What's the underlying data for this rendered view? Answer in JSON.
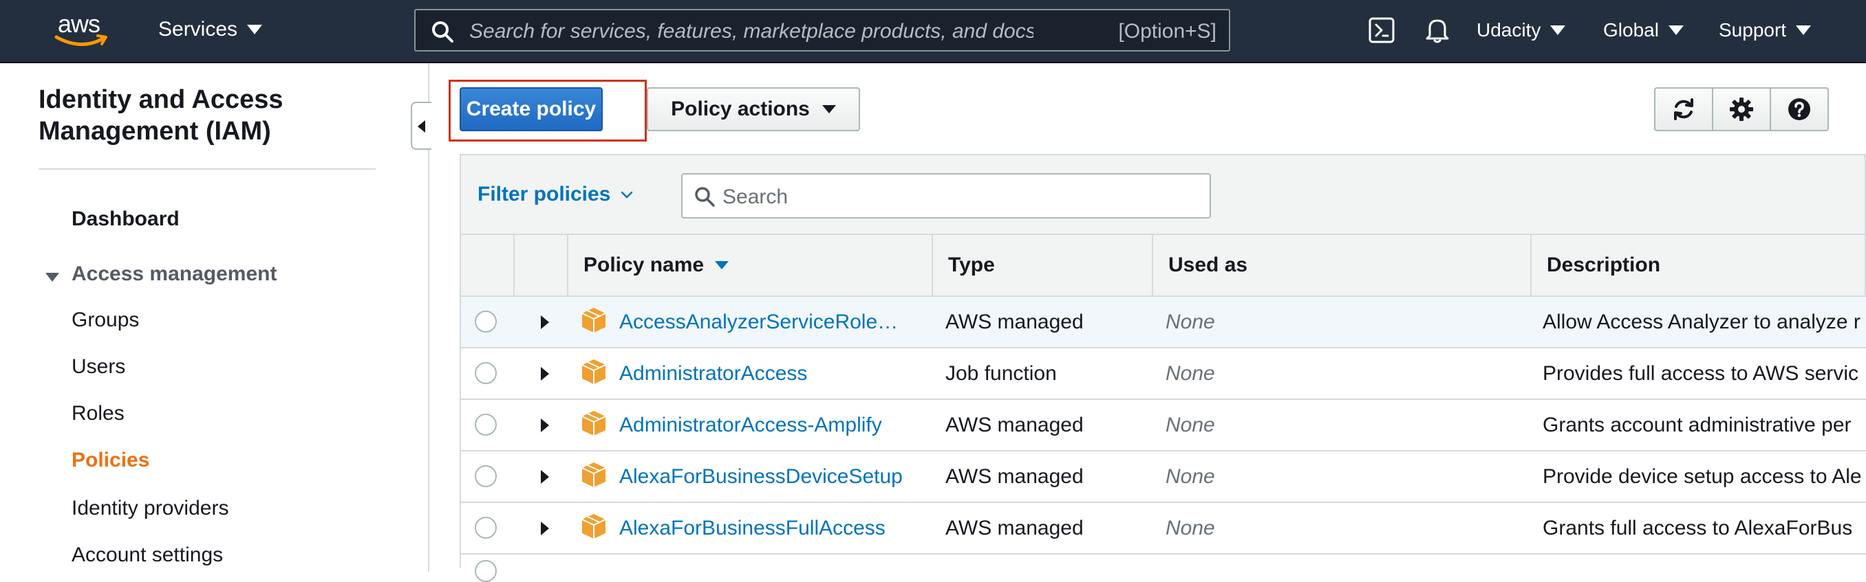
{
  "topnav": {
    "logo_text": "aws",
    "services_label": "Services",
    "search_placeholder": "Search for services, features, marketplace products, and docs",
    "search_shortcut": "[Option+S]",
    "account_label": "Udacity",
    "region_label": "Global",
    "support_label": "Support",
    "icons": [
      "cloudshell-icon",
      "bell-icon"
    ]
  },
  "sidebar": {
    "title": "Identity and Access Management (IAM)",
    "dashboard": "Dashboard",
    "section_label": "Access management",
    "items": [
      {
        "label": "Groups",
        "active": false
      },
      {
        "label": "Users",
        "active": false
      },
      {
        "label": "Roles",
        "active": false
      },
      {
        "label": "Policies",
        "active": true
      },
      {
        "label": "Identity providers",
        "active": false
      },
      {
        "label": "Account settings",
        "active": false
      }
    ]
  },
  "toolbar": {
    "create_label": "Create policy",
    "actions_label": "Policy actions",
    "icon_buttons": [
      "refresh-icon",
      "gear-icon",
      "help-icon"
    ]
  },
  "filter": {
    "label": "Filter policies",
    "search_placeholder": "Search"
  },
  "table": {
    "columns": [
      "Policy name",
      "Type",
      "Used as",
      "Description"
    ],
    "rows": [
      {
        "name": "AccessAnalyzerServiceRole…",
        "type": "AWS managed",
        "used_as": "None",
        "description": "Allow Access Analyzer to analyze r"
      },
      {
        "name": "AdministratorAccess",
        "type": "Job function",
        "used_as": "None",
        "description": "Provides full access to AWS servic"
      },
      {
        "name": "AdministratorAccess-Amplify",
        "type": "AWS managed",
        "used_as": "None",
        "description": "Grants account administrative per"
      },
      {
        "name": "AlexaForBusinessDeviceSetup",
        "type": "AWS managed",
        "used_as": "None",
        "description": "Provide device setup access to Ale"
      },
      {
        "name": "AlexaForBusinessFullAccess",
        "type": "AWS managed",
        "used_as": "None",
        "description": "Grants full access to AlexaForBus"
      }
    ]
  },
  "colors": {
    "nav_bg": "#232f3e",
    "link": "#0073bb",
    "active_nav": "#ec7211",
    "primary_button": "#1f6ac2",
    "highlight": "#d13212",
    "policy_icon": "#f0a030"
  }
}
